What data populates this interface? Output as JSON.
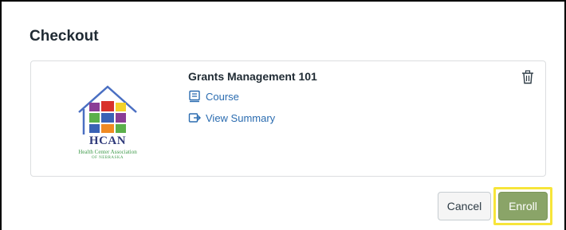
{
  "checkout": {
    "title": "Checkout"
  },
  "logo": {
    "abbr": "HCAN",
    "name": "Health Center Association",
    "tagline": "OF NEBRASKA",
    "colors": {
      "roof": "#4a6fc2",
      "red": "#d8322b",
      "green": "#5bb04a",
      "yellow": "#f2d22b",
      "purple": "#8a3d96",
      "blue": "#3a62b5",
      "orange": "#f08a22"
    }
  },
  "cart_item": {
    "title": "Grants Management 101",
    "type_label": "Course",
    "type_icon": "course-icon",
    "summary_label": "View Summary",
    "summary_icon": "view-summary-icon",
    "remove_icon": "trash-icon"
  },
  "actions": {
    "cancel_label": "Cancel",
    "enroll_label": "Enroll",
    "highlight_color": "#f7e53a",
    "enroll_color": "#8aa468"
  }
}
